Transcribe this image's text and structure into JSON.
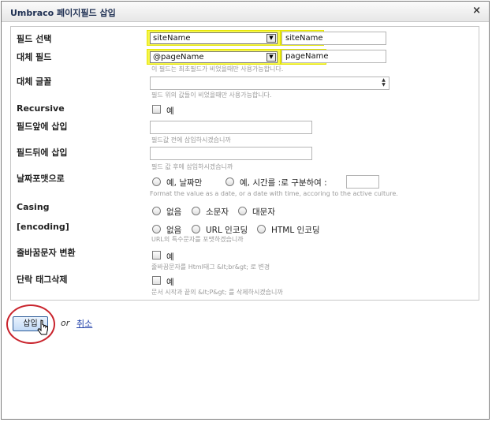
{
  "dialog": {
    "title": "Umbraco 페이지필드 삽입",
    "close_label": "×"
  },
  "fields": {
    "field_select": {
      "label": "필드 선택",
      "value": "siteName",
      "input_value": "siteName"
    },
    "alt_field": {
      "label": "대체 필드",
      "value": "@pageName",
      "input_value": "pageName",
      "hint": "이 필드는 최초필드가 비었을때만 사용가능합니다."
    },
    "alt_text": {
      "label": "대체 글꼴",
      "value": "",
      "hint": "필드 위의 값들이 비었을때만 사용가능합니다."
    },
    "recursive": {
      "label": "Recursive",
      "checkbox_label": "예"
    },
    "insert_before": {
      "label": "필드앞에 삽입",
      "value": "",
      "hint": "필드값 전에 삽입하시겠습니까"
    },
    "insert_after": {
      "label": "필드뒤에 삽입",
      "value": "",
      "hint": "필드 값 후에 삽입하시겠습니까"
    },
    "date_format": {
      "label": "날짜포맷으로",
      "option1": "예, 날짜만",
      "option2": "예, 시간를 :로 구분하여 :",
      "value": "",
      "hint": "Format the value as a date, or a date with time, accoring to the active culture."
    },
    "casing": {
      "label": "Casing",
      "option1": "없음",
      "option2": "소문자",
      "option3": "대문자"
    },
    "encoding": {
      "label": "[encoding]",
      "option1": "없음",
      "option2": "URL 인코딩",
      "option3": "HTML 인코딩",
      "hint": "URL의 특수문자를 포맷하겠습니까"
    },
    "linebreaks": {
      "label": "줄바꿈문자 변환",
      "checkbox_label": "예",
      "hint": "줄바꿈문자를 Html태그 &lt;br&gt; 로 변경"
    },
    "strip_p": {
      "label": "단락 태그삭제",
      "checkbox_label": "예",
      "hint": "문서 시작과 끝의 &lt;P&gt; 를 삭제하시겠습니까"
    }
  },
  "actions": {
    "insert_label": "삽입",
    "or_label": "or",
    "cancel_label": "취소"
  },
  "colors": {
    "highlight": "#f6f64a",
    "annotation_ring": "#c9242d",
    "link": "#1f3fa8"
  }
}
